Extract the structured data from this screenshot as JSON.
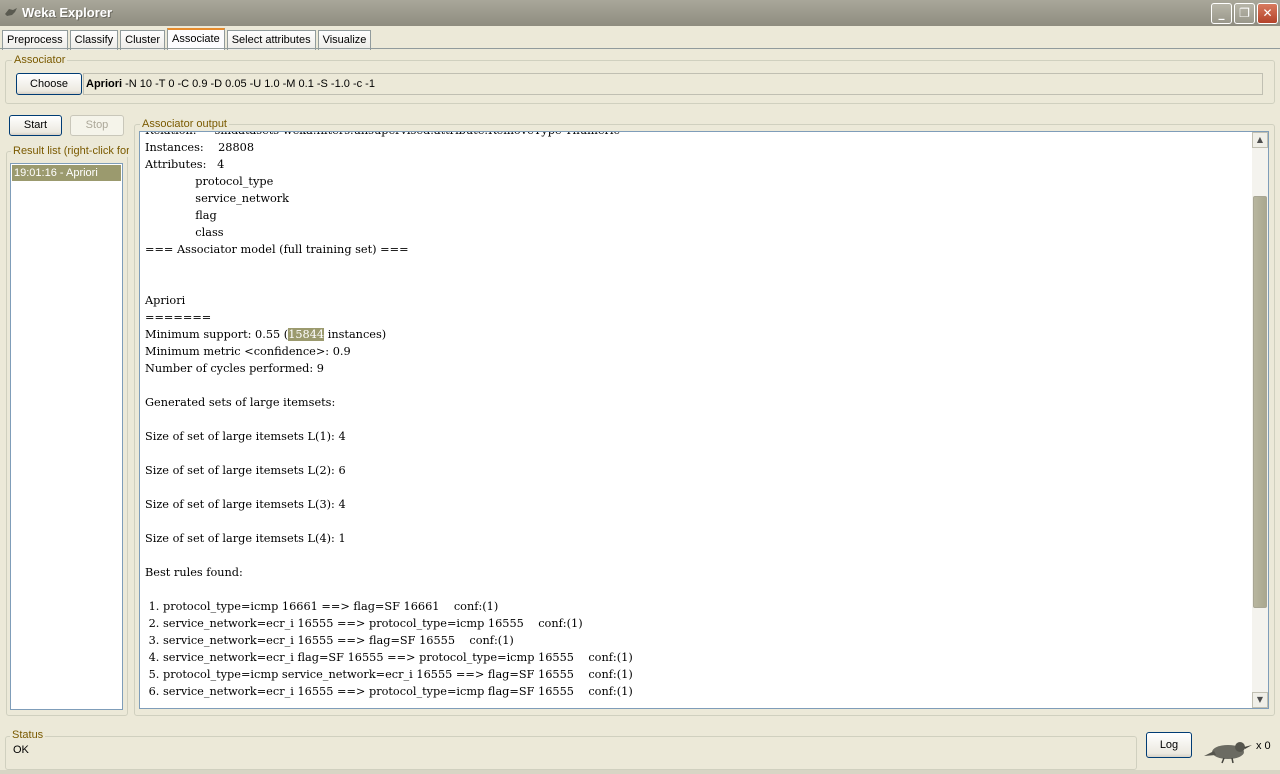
{
  "window": {
    "title": "Weka Explorer",
    "minimize_icon": "minimize-icon",
    "maximize_icon": "restore-icon",
    "close_icon": "close-icon"
  },
  "tabs": [
    {
      "label": "Preprocess"
    },
    {
      "label": "Classify"
    },
    {
      "label": "Cluster"
    },
    {
      "label": "Associate",
      "active": true
    },
    {
      "label": "Select attributes"
    },
    {
      "label": "Visualize"
    }
  ],
  "associator": {
    "group_title": "Associator",
    "choose_label": "Choose",
    "algorithm": "Apriori",
    "options": "-N 10 -T 0 -C 0.9 -D 0.05 -U 1.0 -M 0.1 -S -1.0 -c -1"
  },
  "controls": {
    "start_label": "Start",
    "stop_label": "Stop"
  },
  "result_list": {
    "title": "Result list (right-click for options)",
    "items": [
      "19:01:16 - Apriori"
    ]
  },
  "output": {
    "title": "Associator output",
    "lines_before": [
      "Relation:     smdatasets-weka.filters.unsupervised.attribute.RemoveType-Tnumeric",
      "Instances:    28808",
      "Attributes:   4",
      "              protocol_type",
      "              service_network",
      "              flag",
      "              class",
      "=== Associator model (full training set) ===",
      "",
      "",
      "Apriori",
      "======="
    ],
    "support_prefix": "Minimum support: 0.55 (",
    "support_count": "15844",
    "support_suffix": " instances)",
    "lines_after": [
      "Minimum metric <confidence>: 0.9",
      "Number of cycles performed: 9",
      "",
      "Generated sets of large itemsets:",
      "",
      "Size of set of large itemsets L(1): 4",
      "",
      "Size of set of large itemsets L(2): 6",
      "",
      "Size of set of large itemsets L(3): 4",
      "",
      "Size of set of large itemsets L(4): 1",
      "",
      "Best rules found:",
      "",
      " 1. protocol_type=icmp 16661 ==> flag=SF 16661    conf:(1)",
      " 2. service_network=ecr_i 16555 ==> protocol_type=icmp 16555    conf:(1)",
      " 3. service_network=ecr_i 16555 ==> flag=SF 16555    conf:(1)",
      " 4. service_network=ecr_i flag=SF 16555 ==> protocol_type=icmp 16555    conf:(1)",
      " 5. protocol_type=icmp service_network=ecr_i 16555 ==> flag=SF 16555    conf:(1)",
      " 6. service_network=ecr_i 16555 ==> protocol_type=icmp flag=SF 16555    conf:(1)"
    ]
  },
  "status": {
    "group_title": "Status",
    "text": "OK",
    "log_label": "Log",
    "task_count": "x 0"
  }
}
